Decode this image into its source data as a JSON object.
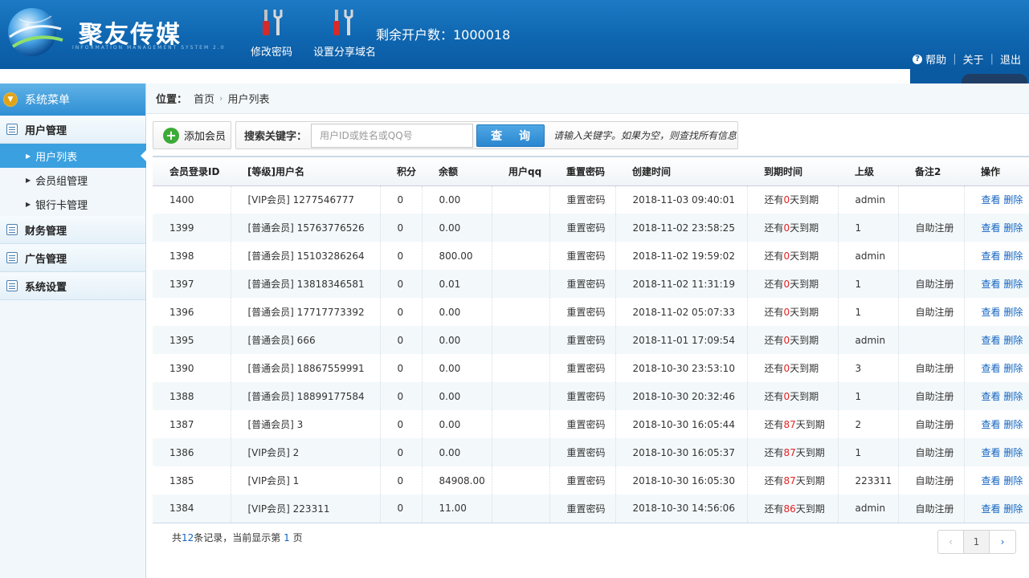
{
  "header": {
    "brand": "聚友传媒",
    "brand_sub": "INFORMATION MANAGEMENT SYSTEM 2.0",
    "tools": [
      {
        "label": "修改密码",
        "icon": "tools-icon"
      },
      {
        "label": "设置分享域名",
        "icon": "tools-icon"
      }
    ],
    "quota": "剩余开户数：1000018",
    "links": {
      "help": "帮助",
      "about": "关于",
      "logout": "退出"
    }
  },
  "sidebar": {
    "title": "系统菜单",
    "groups": [
      {
        "label": "用户管理",
        "items": [
          {
            "label": "用户列表",
            "active": true
          },
          {
            "label": "会员组管理"
          },
          {
            "label": "银行卡管理"
          }
        ]
      },
      {
        "label": "财务管理"
      },
      {
        "label": "广告管理"
      },
      {
        "label": "系统设置"
      }
    ]
  },
  "breadcrumb": {
    "label": "位置：",
    "items": [
      "首页",
      "用户列表"
    ]
  },
  "toolbar": {
    "add_label": "添加会员",
    "search_label": "搜索关键字：",
    "search_placeholder": "用户ID或姓名或QQ号",
    "search_value": "",
    "search_button": "查 询",
    "search_hint": "请输入关键字。如果为空，则查找所有信息"
  },
  "table": {
    "columns": [
      "会员登录ID",
      "[等级]用户名",
      "积分",
      "余额",
      "用户qq",
      "重置密码",
      "创建时间",
      "到期时间",
      "上级",
      "备注2",
      "操作"
    ],
    "expire_prefix": "还有",
    "expire_suffix": "天到期",
    "action_view": "查看",
    "action_delete": "删除",
    "rows": [
      {
        "id": "1400",
        "user": "[VIP会员] 1277546777",
        "points": "0",
        "balance": "0.00",
        "qq": "",
        "reset": "重置密码",
        "created": "2018-11-03 09:40:01",
        "days": "0",
        "parent": "admin",
        "note": ""
      },
      {
        "id": "1399",
        "user": "[普通会员] 15763776526",
        "points": "0",
        "balance": "0.00",
        "qq": "",
        "reset": "重置密码",
        "created": "2018-11-02 23:58:25",
        "days": "0",
        "parent": "1",
        "note": "自助注册"
      },
      {
        "id": "1398",
        "user": "[普通会员] 15103286264",
        "points": "0",
        "balance": "800.00",
        "qq": "",
        "reset": "重置密码",
        "created": "2018-11-02 19:59:02",
        "days": "0",
        "parent": "admin",
        "note": ""
      },
      {
        "id": "1397",
        "user": "[普通会员] 13818346581",
        "points": "0",
        "balance": "0.01",
        "qq": "",
        "reset": "重置密码",
        "created": "2018-11-02 11:31:19",
        "days": "0",
        "parent": "1",
        "note": "自助注册"
      },
      {
        "id": "1396",
        "user": "[普通会员] 17717773392",
        "points": "0",
        "balance": "0.00",
        "qq": "",
        "reset": "重置密码",
        "created": "2018-11-02 05:07:33",
        "days": "0",
        "parent": "1",
        "note": "自助注册"
      },
      {
        "id": "1395",
        "user": "[普通会员] 666",
        "points": "0",
        "balance": "0.00",
        "qq": "",
        "reset": "重置密码",
        "created": "2018-11-01 17:09:54",
        "days": "0",
        "parent": "admin",
        "note": ""
      },
      {
        "id": "1390",
        "user": "[普通会员] 18867559991",
        "points": "0",
        "balance": "0.00",
        "qq": "",
        "reset": "重置密码",
        "created": "2018-10-30 23:53:10",
        "days": "0",
        "parent": "3",
        "note": "自助注册"
      },
      {
        "id": "1388",
        "user": "[普通会员] 18899177584",
        "points": "0",
        "balance": "0.00",
        "qq": "",
        "reset": "重置密码",
        "created": "2018-10-30 20:32:46",
        "days": "0",
        "parent": "1",
        "note": "自助注册"
      },
      {
        "id": "1387",
        "user": "[普通会员] 3",
        "points": "0",
        "balance": "0.00",
        "qq": "",
        "reset": "重置密码",
        "created": "2018-10-30 16:05:44",
        "days": "87",
        "parent": "2",
        "note": "自助注册"
      },
      {
        "id": "1386",
        "user": "[VIP会员] 2",
        "points": "0",
        "balance": "0.00",
        "qq": "",
        "reset": "重置密码",
        "created": "2018-10-30 16:05:37",
        "days": "87",
        "parent": "1",
        "note": "自助注册"
      },
      {
        "id": "1385",
        "user": "[VIP会员] 1",
        "points": "0",
        "balance": "84908.00",
        "qq": "",
        "reset": "重置密码",
        "created": "2018-10-30 16:05:30",
        "days": "87",
        "parent": "223311",
        "note": "自助注册"
      },
      {
        "id": "1384",
        "user": "[VIP会员] 223311",
        "points": "0",
        "balance": "11.00",
        "qq": "",
        "reset": "重置密码",
        "created": "2018-10-30 14:56:06",
        "days": "86",
        "parent": "admin",
        "note": "自助注册"
      }
    ]
  },
  "pager": {
    "info_prefix": "共",
    "total": "12",
    "info_mid": "条记录，当前显示第 ",
    "current": "1",
    "info_suffix": " 页",
    "page": "1"
  },
  "colors": {
    "header": "#0f66b0",
    "accent": "#3aa0df",
    "expire_red": "#e02222",
    "link": "#1565c0"
  }
}
